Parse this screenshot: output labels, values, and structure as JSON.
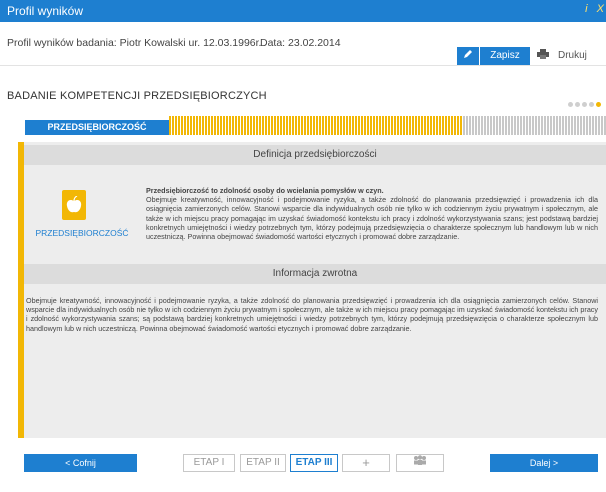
{
  "window": {
    "title": "Profil wyników",
    "icons": [
      "info-icon",
      "close-icon"
    ],
    "info_glyph": "i",
    "close_glyph": "X"
  },
  "header": {
    "subject": "Profil wyników badania: Piotr Kowalski ur. 12.03.1996r.",
    "date": "Data: 23.02.2014",
    "save_label": "Zapisz",
    "print_label": "Drukuj"
  },
  "section": {
    "title": "BADANIE KOMPETENCJI PRZEDSIĘBIORCZYCH",
    "step_dots": 5,
    "active_dot": 5
  },
  "competency": {
    "tab_label": "PRZEDSIĘBIORCZOŚĆ",
    "progress_fraction": 0.67,
    "definition_header": "Definicja przedsiębiorczości",
    "icon_label": "PRZEDSIĘBIORCZOŚĆ",
    "definition_lead": "Przedsiębiorczość to zdolność osoby do wcielania pomysłów w czyn.",
    "definition_body": "Obejmuje kreatywność, innowacyjność i podejmowanie ryzyka, a także zdolność do planowania przedsięwzięć i prowadzenia ich dla osiągnięcia zamierzonych celów. Stanowi wsparcie dla indywidualnych osób nie tylko w ich codziennym życiu prywatnym i społecznym, ale także w ich miejscu pracy pomagając im uzyskać świadomość kontekstu ich pracy i zdolność wykorzystywania szans; jest podstawą bardziej konkretnych umiejętności i wiedzy potrzebnych tym, którzy podejmują przedsięwzięcia o charakterze społecznym lub handlowym lub w nich uczestniczą. Powinna obejmować świadomość wartości etycznych i promować dobre zarządzanie.",
    "feedback_header": "Informacja zwrotna",
    "feedback_body": "Obejmuje kreatywność, innowacyjność i podejmowanie ryzyka, a także zdolność do planowania przedsięwzięć i prowadzenia ich dla osiągnięcia zamierzonych celów. Stanowi wsparcie dla indywidualnych osób nie tylko w ich codziennym życiu prywatnym i społecznym, ale także w ich miejscu pracy pomagając im uzyskać świadomość kontekstu ich pracy i zdolność wykorzystywania szans; są podstawą bardziej konkretnych umiejętności i wiedzy potrzebnych tym, którzy podejmują przedsięwzięcia o charakterze społecznym lub handlowym lub w nich uczestniczą. Powinna obejmować świadomość wartości etycznych i promować dobre zarządzanie."
  },
  "nav": {
    "prev_label": "<  Cofnij",
    "next_label": "Dalej  >",
    "stages": [
      "ETAP I",
      "ETAP II",
      "ETAP III",
      "+",
      ""
    ],
    "active_stage": "ETAP III"
  },
  "colors": {
    "primary": "#1e7fd0",
    "accent": "#f2b705",
    "panel": "#ededed",
    "band": "#dcdcdc"
  }
}
